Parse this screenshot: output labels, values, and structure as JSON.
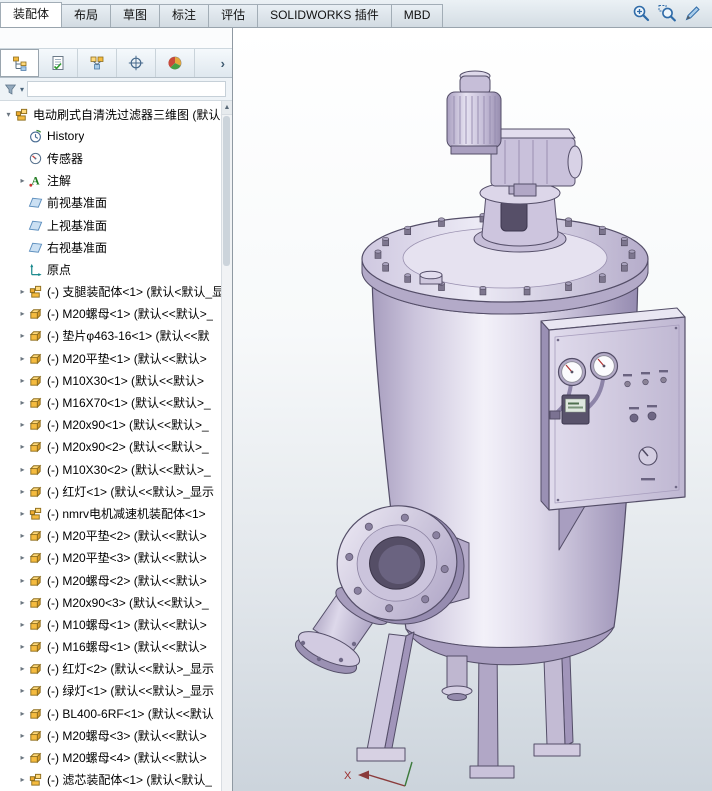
{
  "ribbon": {
    "tabs": [
      {
        "label": "装配体",
        "active": true
      },
      {
        "label": "布局",
        "active": false
      },
      {
        "label": "草图",
        "active": false
      },
      {
        "label": "标注",
        "active": false
      },
      {
        "label": "评估",
        "active": false
      },
      {
        "label": "SOLIDWORKS 插件",
        "active": false
      },
      {
        "label": "MBD",
        "active": false
      }
    ],
    "right_tools": [
      {
        "name": "zoom-in"
      },
      {
        "name": "zoom-area"
      },
      {
        "name": "edit-pencil"
      }
    ]
  },
  "panel": {
    "manager_tabs": [
      {
        "name": "featuremanager",
        "active": true
      },
      {
        "name": "propertymanager",
        "active": false
      },
      {
        "name": "configurationmanager",
        "active": false
      },
      {
        "name": "dimxpertmanager",
        "active": false
      },
      {
        "name": "displaymanager",
        "active": false
      }
    ],
    "collapse_icon": "chevron-right",
    "filter": {
      "funnel_icon": "filter-funnel",
      "dropdown_icon": "chevron-down",
      "value": ""
    },
    "scroll_up_icon": "triangle-up",
    "tree": {
      "root": {
        "label": "电动刷式自清洗过滤器三维图 (默认<",
        "icon": "assembly",
        "arrow": true
      },
      "items": [
        {
          "label": "History",
          "icon": "history",
          "arrow": false
        },
        {
          "label": "传感器",
          "icon": "sensor",
          "arrow": false
        },
        {
          "label": "注解",
          "icon": "annotation",
          "arrow": true
        },
        {
          "label": "前视基准面",
          "icon": "plane",
          "arrow": false
        },
        {
          "label": "上视基准面",
          "icon": "plane",
          "arrow": false
        },
        {
          "label": "右视基准面",
          "icon": "plane",
          "arrow": false
        },
        {
          "label": "原点",
          "icon": "origin",
          "arrow": false
        },
        {
          "label": "(-) 支腿装配体<1> (默认<默认_显",
          "icon": "assembly",
          "arrow": true
        },
        {
          "label": "(-) M20螺母<1> (默认<<默认>_",
          "icon": "part",
          "arrow": true
        },
        {
          "label": "(-) 垫片φ463-16<1> (默认<<默",
          "icon": "part",
          "arrow": true
        },
        {
          "label": "(-) M20平垫<1> (默认<<默认>",
          "icon": "part",
          "arrow": true
        },
        {
          "label": "(-) M10X30<1> (默认<<默认>",
          "icon": "part",
          "arrow": true
        },
        {
          "label": "(-) M16X70<1> (默认<<默认>_",
          "icon": "part",
          "arrow": true
        },
        {
          "label": "(-) M20x90<1> (默认<<默认>_",
          "icon": "part",
          "arrow": true
        },
        {
          "label": "(-) M20x90<2> (默认<<默认>_",
          "icon": "part",
          "arrow": true
        },
        {
          "label": "(-) M10X30<2> (默认<<默认>_",
          "icon": "part",
          "arrow": true
        },
        {
          "label": "(-) 红灯<1> (默认<<默认>_显示",
          "icon": "part",
          "arrow": true
        },
        {
          "label": "(-) nmrv电机减速机装配体<1>",
          "icon": "assembly",
          "arrow": true
        },
        {
          "label": "(-) M20平垫<2> (默认<<默认>",
          "icon": "part",
          "arrow": true
        },
        {
          "label": "(-) M20平垫<3> (默认<<默认>",
          "icon": "part",
          "arrow": true
        },
        {
          "label": "(-) M20螺母<2> (默认<<默认>",
          "icon": "part",
          "arrow": true
        },
        {
          "label": "(-) M20x90<3> (默认<<默认>_",
          "icon": "part",
          "arrow": true
        },
        {
          "label": "(-) M10螺母<1> (默认<<默认>",
          "icon": "part",
          "arrow": true
        },
        {
          "label": "(-) M16螺母<1> (默认<<默认>",
          "icon": "part",
          "arrow": true
        },
        {
          "label": "(-) 红灯<2> (默认<<默认>_显示",
          "icon": "part",
          "arrow": true
        },
        {
          "label": "(-) 绿灯<1> (默认<<默认>_显示",
          "icon": "part",
          "arrow": true
        },
        {
          "label": "(-) BL400-6RF<1> (默认<<默认",
          "icon": "part",
          "arrow": true
        },
        {
          "label": "(-) M20螺母<3> (默认<<默认>",
          "icon": "part",
          "arrow": true
        },
        {
          "label": "(-) M20螺母<4> (默认<<默认>",
          "icon": "part",
          "arrow": true
        },
        {
          "label": "(-) 滤芯装配体<1> (默认<默认_",
          "icon": "assembly",
          "arrow": true
        }
      ]
    }
  },
  "viewport": {
    "triad": {
      "x_label": "X"
    }
  },
  "colors": {
    "accent_blue": "#2f6ba8",
    "model_lavender_light": "#e9e6f3",
    "model_lavender": "#c9c1db",
    "model_lavender_dark": "#9a90b4",
    "ribbon_bg": "#dde5eb",
    "panel_border": "#8f99a2",
    "viewport_gradient_bottom": "#cfd7de"
  }
}
